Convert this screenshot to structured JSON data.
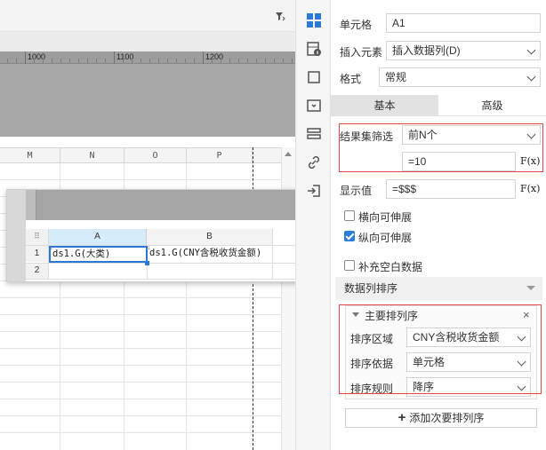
{
  "editor": {
    "ruler_labels": [
      "1000",
      "1100",
      "1200"
    ],
    "columns": [
      "M",
      "N",
      "O",
      "P"
    ]
  },
  "preview": {
    "columns": [
      "A",
      "B"
    ],
    "rows": [
      "1",
      "2"
    ],
    "cell_a1": "ds1.G(大类)",
    "cell_b1": "ds1.G(CNY含税收货金额)"
  },
  "panel": {
    "cell_label": "单元格",
    "cell_value": "A1",
    "insert_label": "插入元素",
    "insert_value": "插入数据列(D)",
    "format_label": "格式",
    "format_value": "常规",
    "tabs": {
      "basic": "基本",
      "advanced": "高级"
    },
    "filter_label": "结果集筛选",
    "filter_value": "前N个",
    "filter_formula": "=10",
    "display_label": "显示值",
    "display_value": "=$$$",
    "fx": "F(x)",
    "checkboxes": [
      {
        "label": "横向可伸展",
        "checked": false
      },
      {
        "label": "纵向可伸展",
        "checked": true
      },
      {
        "label": "补充空白数据",
        "checked": false
      }
    ],
    "section_title": "数据列排序",
    "sort": {
      "title": "主要排列序",
      "area_label": "排序区域",
      "area_value": "CNY含税收货金额",
      "basis_label": "排序依据",
      "basis_value": "单元格",
      "rule_label": "排序规则",
      "rule_value": "降序"
    },
    "add_button": "添加次要排列序",
    "close": "×"
  },
  "colors": {
    "accent": "#2b79d7",
    "highlight_border": "#e0474c",
    "selected_col_header": "#d7ecfa"
  }
}
